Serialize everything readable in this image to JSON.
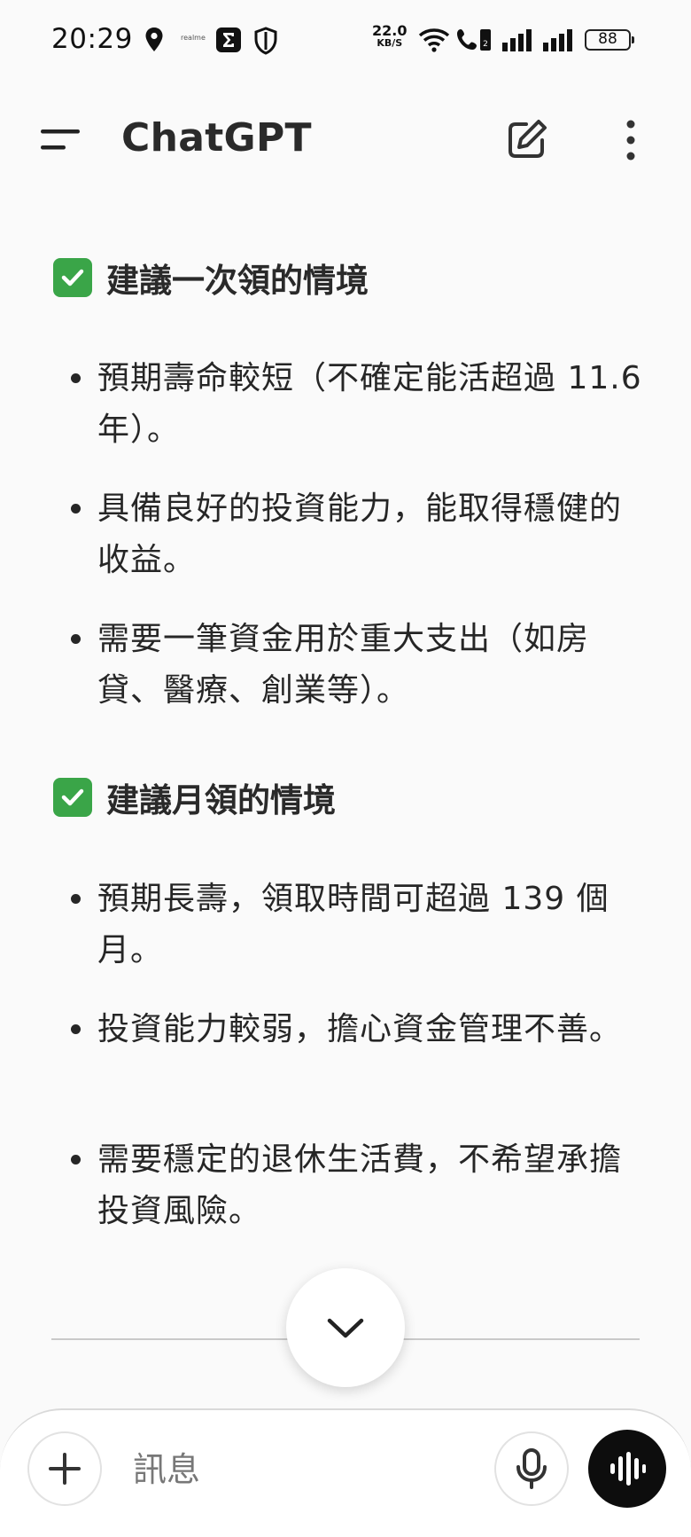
{
  "status_bar": {
    "time": "20:29",
    "realme_label": "realme",
    "net_speed_value": "22.0",
    "net_speed_unit": "KB/S",
    "battery_level": "88"
  },
  "app_bar": {
    "title": "ChatGPT",
    "icons": [
      "menu-icon",
      "new-chat-icon",
      "more-vertical-icon"
    ]
  },
  "sections": [
    {
      "heading": "建議一次領的情境",
      "items": [
        "預期壽命較短（不確定能活超過 11.6 年）。",
        "具備良好的投資能力，能取得穩健的收益。",
        "需要一筆資金用於重大支出（如房貸、醫療、創業等）。"
      ]
    },
    {
      "heading": "建議月領的情境",
      "items": [
        "預期長壽，領取時間可超過 139 個月。",
        "投資能力較弱，擔心資金管理不善。",
        "需要穩定的退休生活費，不希望承擔投資風險。"
      ]
    }
  ],
  "composer": {
    "placeholder": "訊息",
    "icons": [
      "plus-icon",
      "mic-icon",
      "voice-wave-icon"
    ]
  },
  "colors": {
    "background": "#fafafa",
    "check_green": "#3aa548",
    "voice_button": "#0d0d0d"
  }
}
